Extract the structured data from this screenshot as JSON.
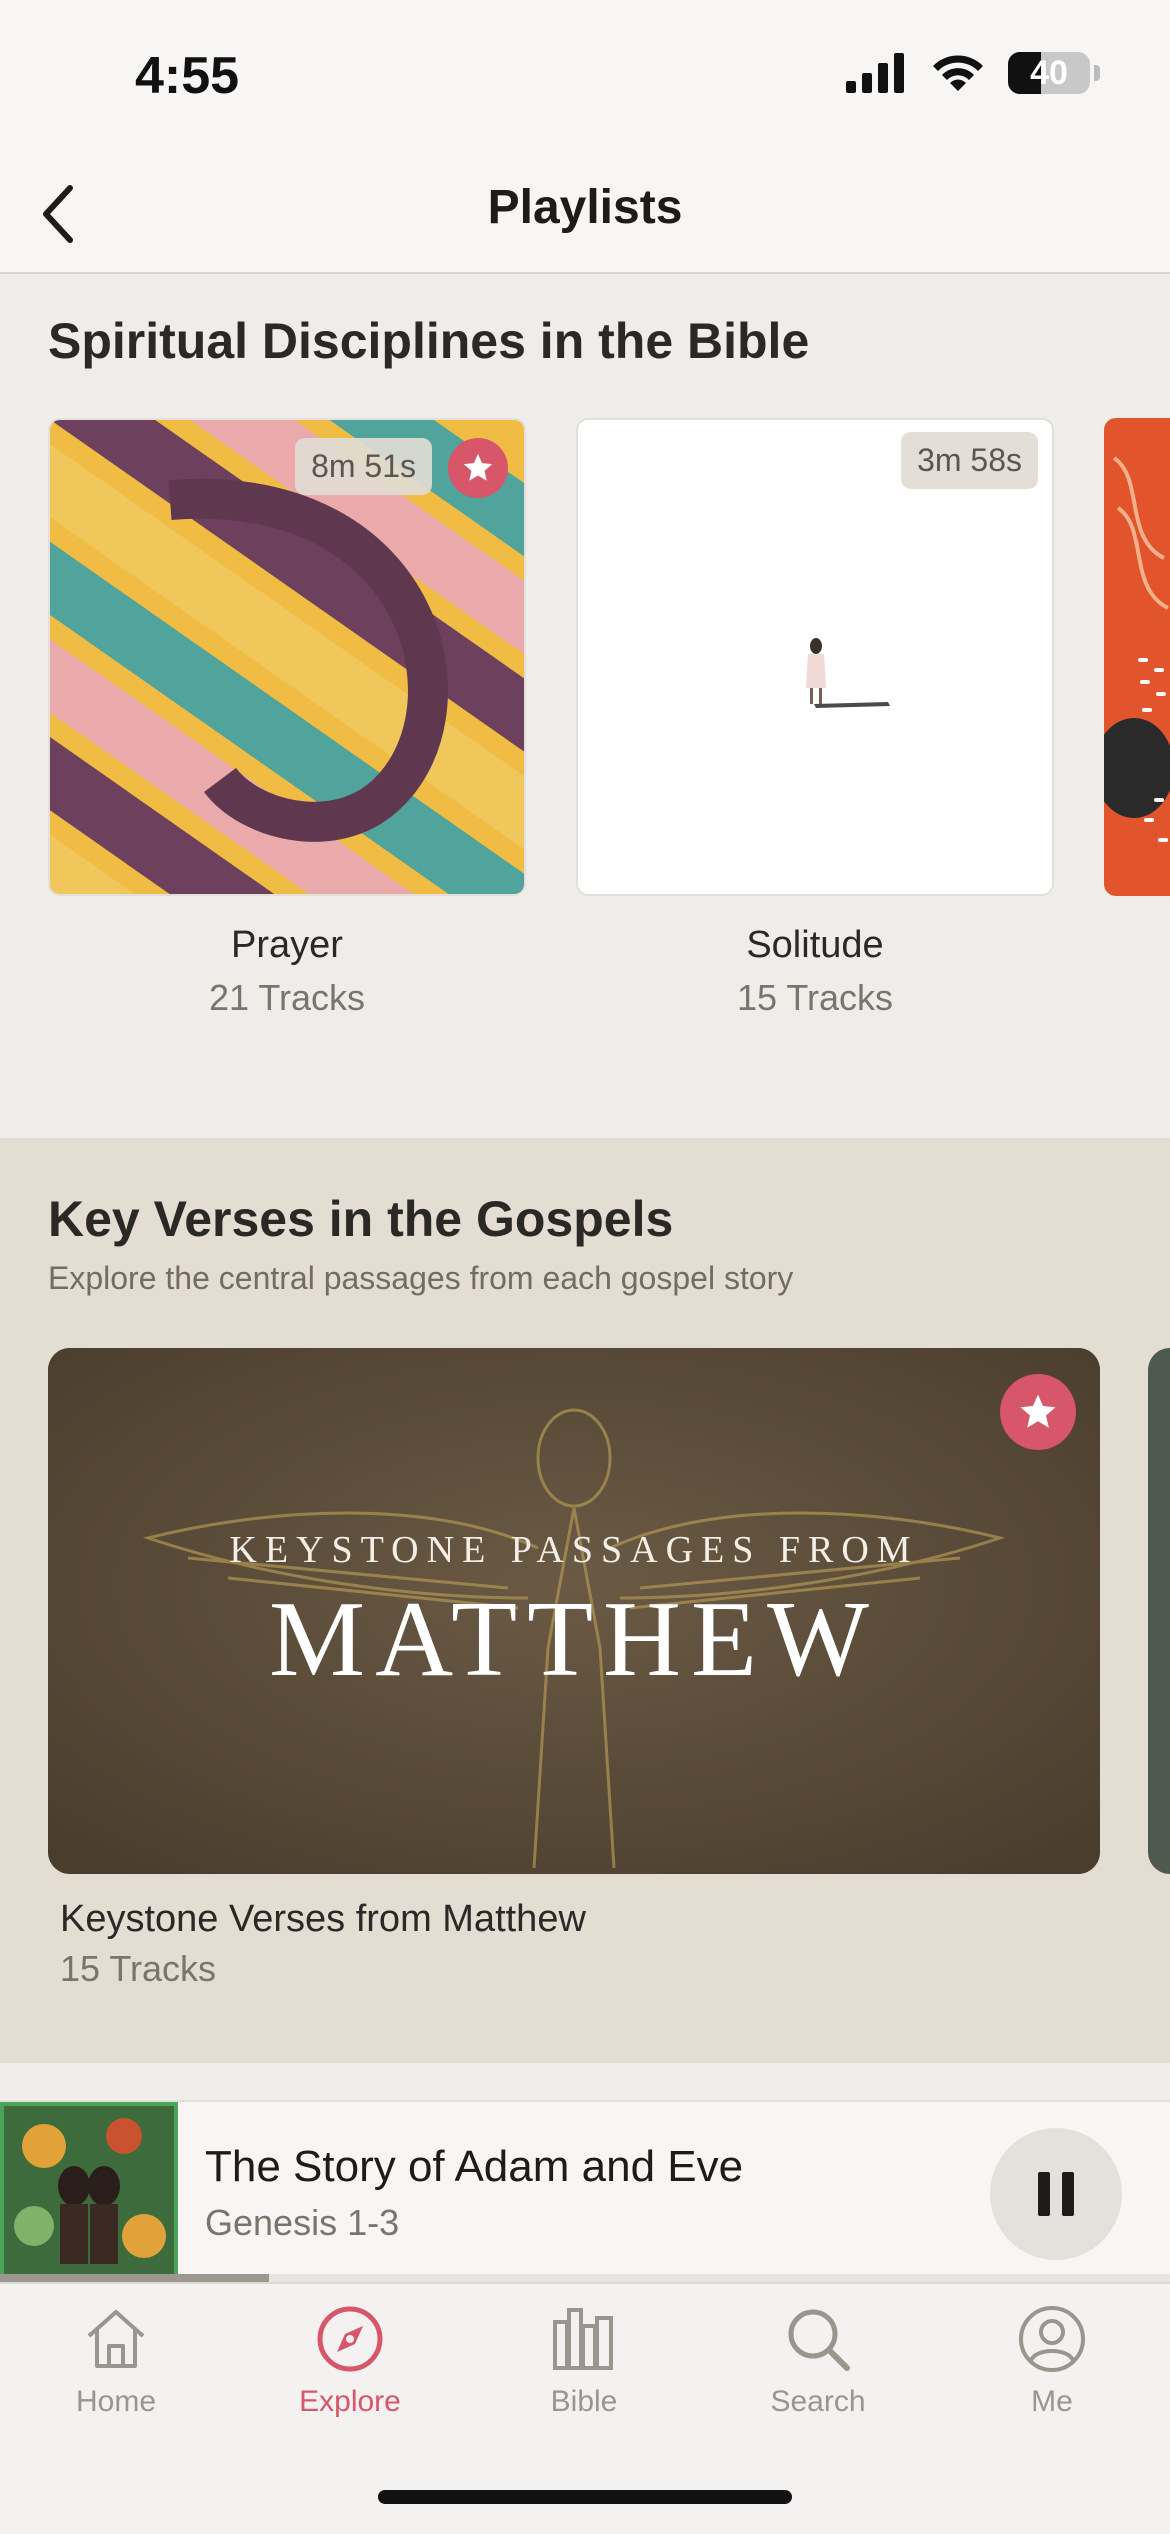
{
  "status_bar": {
    "time": "4:55",
    "battery": "40"
  },
  "nav": {
    "title": "Playlists"
  },
  "section1": {
    "title": "Spiritual Disciplines in the Bible",
    "cards": [
      {
        "duration": "8m 51s",
        "starred": true,
        "title": "Prayer",
        "tracks": "21 Tracks"
      },
      {
        "duration": "3m 58s",
        "starred": false,
        "title": "Solitude",
        "tracks": "15 Tracks"
      }
    ]
  },
  "section2": {
    "title": "Key Verses in the Gospels",
    "subtitle": "Explore the central passages from each gospel story",
    "card": {
      "art_top": "KEYSTONE PASSAGES FROM",
      "art_main": "MATTHEW",
      "title": "Keystone Verses from Matthew",
      "tracks": "15 Tracks"
    }
  },
  "mini_player": {
    "title": "The Story of Adam and Eve",
    "subtitle": "Genesis 1-3",
    "progress": 0.23
  },
  "tabs": [
    {
      "label": "Home",
      "icon": "home-icon",
      "active": false
    },
    {
      "label": "Explore",
      "icon": "compass-icon",
      "active": true
    },
    {
      "label": "Bible",
      "icon": "bible-shelf-icon",
      "active": false
    },
    {
      "label": "Search",
      "icon": "search-icon",
      "active": false
    },
    {
      "label": "Me",
      "icon": "profile-icon",
      "active": false
    }
  ],
  "colors": {
    "accent": "#d8566a",
    "inactive_tab": "#9a958e"
  }
}
